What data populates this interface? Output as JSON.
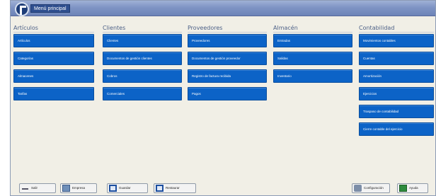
{
  "window": {
    "title": "Menú principal"
  },
  "columns": [
    {
      "header": "Artículos",
      "buttons": [
        "Artículos",
        "Categorías",
        "Almacenes",
        "Tarifas"
      ]
    },
    {
      "header": "Clientes",
      "buttons": [
        "Clientes",
        "Documentos de gestión clientes",
        "Cobros",
        "Comerciales"
      ]
    },
    {
      "header": "Proveedores",
      "buttons": [
        "Proveedores",
        "Documentos de gestión proveedor",
        "Registro de factura recibida",
        "Pagos"
      ]
    },
    {
      "header": "Almacén",
      "buttons": [
        "Entradas",
        "Salidas",
        "Inventario"
      ]
    },
    {
      "header": "Contabilidad",
      "buttons": [
        "Movimientos contables",
        "Cuentas",
        "Amortización",
        "Ejercicios",
        "Traspaso de contabilidad",
        "Cierre contable del ejercicio"
      ]
    }
  ],
  "bottom": {
    "exit": "Salir",
    "database": "Empresa",
    "save": "Guardar",
    "restore": "Restaurar",
    "config": "Configuración",
    "help": "Ayuda"
  }
}
